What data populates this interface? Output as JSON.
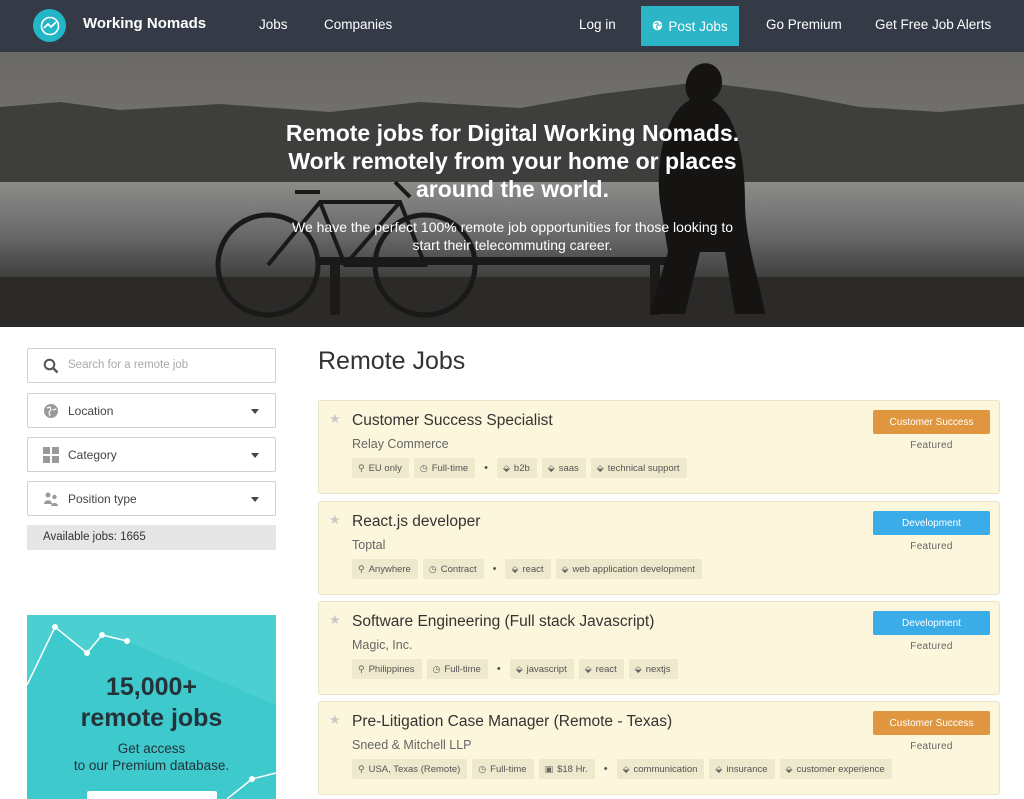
{
  "nav": {
    "brand": "Working Nomads",
    "jobs": "Jobs",
    "companies": "Companies",
    "login": "Log in",
    "post_jobs": "Post Jobs",
    "premium": "Go Premium",
    "alerts": "Get Free Job Alerts"
  },
  "hero": {
    "title_line1": "Remote jobs for Digital Working Nomads.",
    "title_line2": "Work remotely from your home or places",
    "title_line3": "around the world.",
    "sub_line1": "We have the perfect 100% remote job opportunities for those looking to",
    "sub_line2": "start their telecommuting career."
  },
  "sidebar": {
    "search_placeholder": "Search for a remote job",
    "location": "Location",
    "category": "Category",
    "position_type": "Position type",
    "available": "Available jobs: 1665",
    "promo_big1": "15,000+",
    "promo_big2": "remote jobs",
    "promo_small1": "Get access",
    "promo_small2": "to our Premium database."
  },
  "main": {
    "title": "Remote Jobs"
  },
  "colors": {
    "accent": "#2bb5c6",
    "customer_success": "#e0963f",
    "development": "#3aace8"
  },
  "jobs": [
    {
      "title": "Customer Success Specialist",
      "company": "Relay Commerce",
      "category": "Customer Success",
      "featured": "Featured",
      "location": "EU only",
      "type": "Full-time",
      "tags": [
        "b2b",
        "saas",
        "technical support"
      ]
    },
    {
      "title": "React.js developer",
      "company": "Toptal",
      "category": "Development",
      "featured": "Featured",
      "location": "Anywhere",
      "type": "Contract",
      "tags": [
        "react",
        "web application development"
      ]
    },
    {
      "title": "Software Engineering (Full stack Javascript)",
      "company": "Magic, Inc.",
      "category": "Development",
      "featured": "Featured",
      "location": "Philippines",
      "type": "Full-time",
      "tags": [
        "javascript",
        "react",
        "nextjs"
      ]
    },
    {
      "title": "Pre-Litigation Case Manager (Remote - Texas)",
      "company": "Sneed & Mitchell LLP",
      "category": "Customer Success",
      "featured": "Featured",
      "location": "USA, Texas (Remote)",
      "type": "Full-time",
      "salary": "$18 Hr.",
      "tags": [
        "communication",
        "insurance",
        "customer experience"
      ]
    }
  ]
}
